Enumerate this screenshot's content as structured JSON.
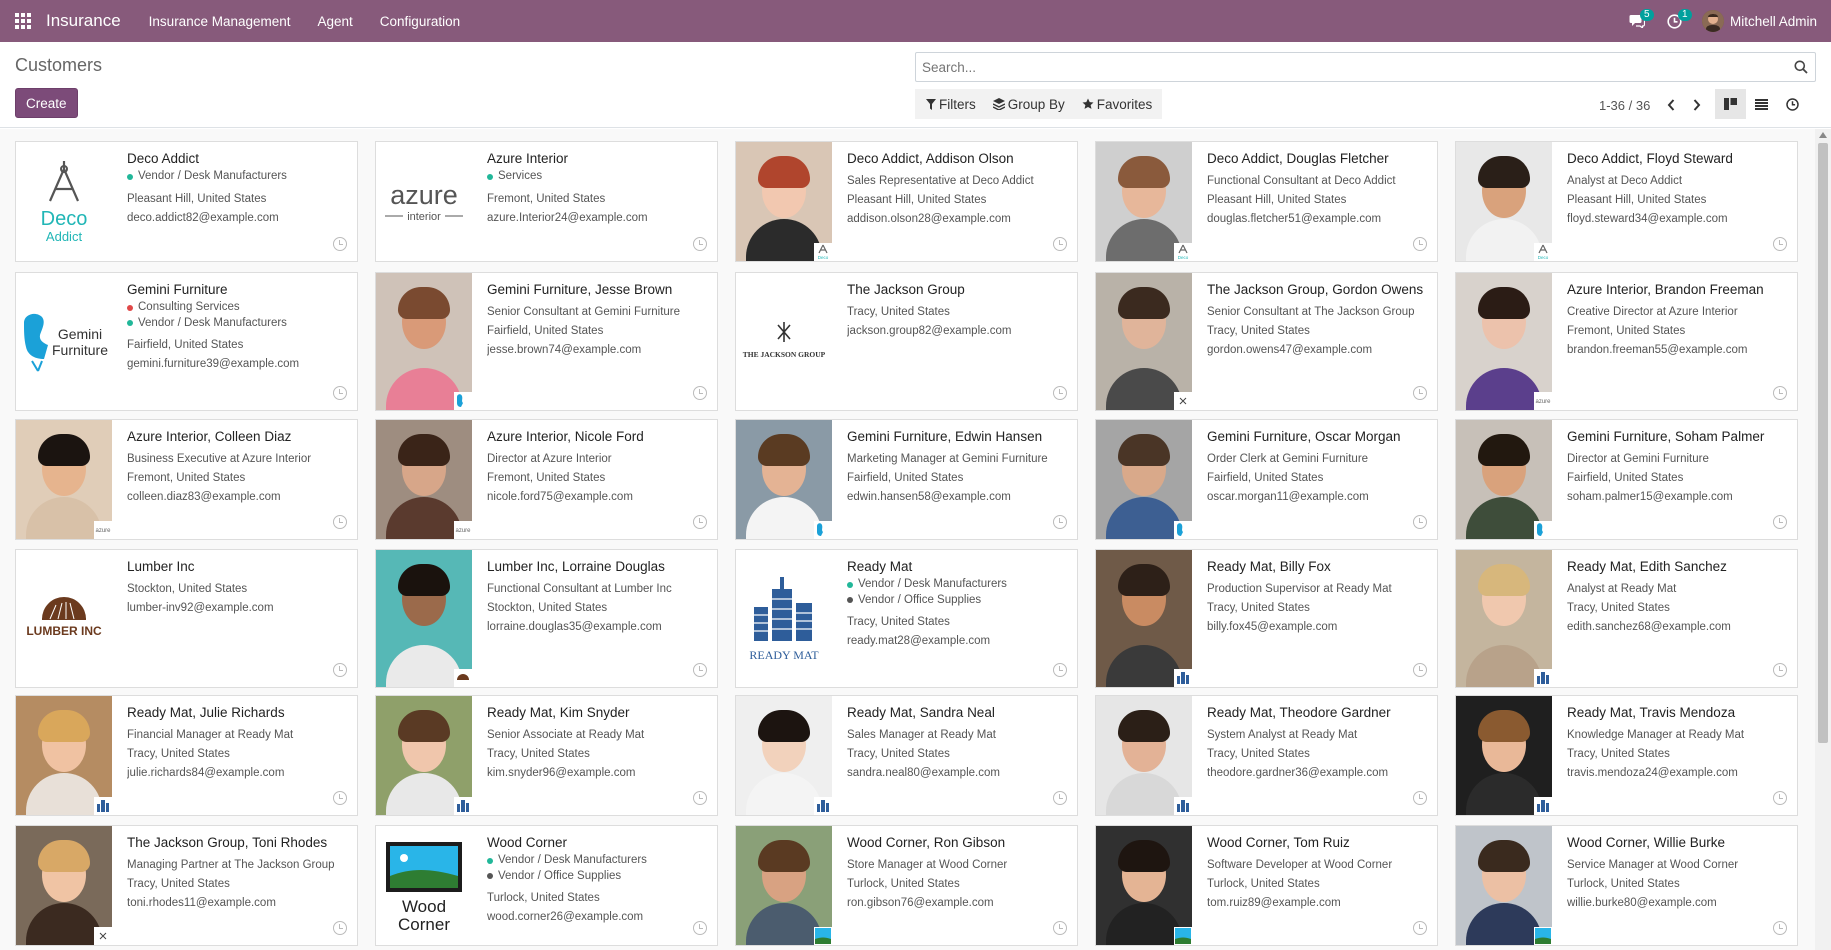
{
  "navbar": {
    "brand": "Insurance",
    "menus": [
      "Insurance Management",
      "Agent",
      "Configuration"
    ],
    "messages_count": "5",
    "activities_count": "1",
    "user_name": "Mitchell Admin",
    "color": "#875a7b"
  },
  "control_panel": {
    "title": "Customers",
    "create_label": "Create",
    "search_placeholder": "Search...",
    "filters_label": "Filters",
    "group_by_label": "Group By",
    "favorites_label": "Favorites",
    "pager": "1-36 / 36"
  },
  "tag_colors": {
    "green": "#21b799",
    "red": "#e04848",
    "dark": "#555555"
  },
  "cards": [
    {
      "name": "Deco Addict",
      "tags": [
        {
          "label": "Vendor / Desk Manufacturers",
          "color": "green"
        }
      ],
      "lines": [
        "Pleasant Hill, United States",
        "deco.addict82@example.com"
      ],
      "image": "logo-deco",
      "logo_text": [
        "Deco",
        "Addict"
      ]
    },
    {
      "name": "Azure Interior",
      "tags": [
        {
          "label": "Services",
          "color": "green"
        }
      ],
      "lines": [
        "Fremont, United States",
        "azure.Interior24@example.com"
      ],
      "image": "logo-azure",
      "logo_text": [
        "azure",
        "interior"
      ]
    },
    {
      "name": "Deco Addict, Addison Olson",
      "tags": [],
      "lines": [
        "Sales Representative at Deco Addict",
        "Pleasant Hill, United States",
        "addison.olson28@example.com"
      ],
      "image": "portrait",
      "hair": "#b0452d",
      "skin": "#f2c8b0",
      "shirt": "#2b2b2b",
      "bg": "#d9c6b5",
      "mini": "deco"
    },
    {
      "name": "Deco Addict, Douglas Fletcher",
      "tags": [],
      "lines": [
        "Functional Consultant at Deco Addict",
        "Pleasant Hill, United States",
        "douglas.fletcher51@example.com"
      ],
      "image": "portrait",
      "hair": "#8a5a3c",
      "skin": "#e7b79a",
      "shirt": "#6d6d6d",
      "bg": "#cfcfcf",
      "mini": "deco"
    },
    {
      "name": "Deco Addict, Floyd Steward",
      "tags": [],
      "lines": [
        "Analyst at Deco Addict",
        "Pleasant Hill, United States",
        "floyd.steward34@example.com"
      ],
      "image": "portrait",
      "hair": "#2a1f18",
      "skin": "#d9a27c",
      "shirt": "#f2f2f2",
      "bg": "#e8e8e8",
      "mini": "deco"
    },
    {
      "name": "Gemini Furniture",
      "tags": [
        {
          "label": "Consulting Services",
          "color": "red"
        },
        {
          "label": "Vendor / Desk Manufacturers",
          "color": "green"
        }
      ],
      "lines": [
        "Fairfield, United States",
        "gemini.furniture39@example.com"
      ],
      "image": "logo-gemini",
      "logo_text": [
        "Gemini",
        "Furniture"
      ]
    },
    {
      "name": "Gemini Furniture, Jesse Brown",
      "tags": [],
      "lines": [
        "Senior Consultant at Gemini Furniture",
        "Fairfield, United States",
        "jesse.brown74@example.com"
      ],
      "image": "portrait",
      "hair": "#7a4a30",
      "skin": "#d99a78",
      "shirt": "#e87f96",
      "bg": "#cfc2b8",
      "mini": "gemini"
    },
    {
      "name": "The Jackson Group",
      "tags": [],
      "lines": [
        "Tracy, United States",
        "jackson.group82@example.com"
      ],
      "image": "logo-jackson",
      "logo_text": [
        "THE JACKSON GROUP"
      ]
    },
    {
      "name": "The Jackson Group, Gordon Owens",
      "tags": [],
      "lines": [
        "Senior Consultant at The Jackson Group",
        "Tracy, United States",
        "gordon.owens47@example.com"
      ],
      "image": "portrait",
      "hair": "#3b2a1f",
      "skin": "#e0b49a",
      "shirt": "#4a4a4a",
      "bg": "#b9b2a8",
      "mini": "jackson"
    },
    {
      "name": "Azure Interior, Brandon Freeman",
      "tags": [],
      "lines": [
        "Creative Director at Azure Interior",
        "Fremont, United States",
        "brandon.freeman55@example.com"
      ],
      "image": "portrait",
      "hair": "#2b1c15",
      "skin": "#ecc2ac",
      "shirt": "#5b3f8c",
      "bg": "#d8d2cc",
      "mini": "azure"
    },
    {
      "name": "Azure Interior, Colleen Diaz",
      "tags": [],
      "lines": [
        "Business Executive at Azure Interior",
        "Fremont, United States",
        "colleen.diaz83@example.com"
      ],
      "image": "portrait",
      "hair": "#1b1410",
      "skin": "#e6b48e",
      "shirt": "#d8c1a8",
      "bg": "#e0cdb8",
      "mini": "azure"
    },
    {
      "name": "Azure Interior, Nicole Ford",
      "tags": [],
      "lines": [
        "Director at Azure Interior",
        "Fremont, United States",
        "nicole.ford75@example.com"
      ],
      "image": "portrait",
      "hair": "#3a2418",
      "skin": "#d7a689",
      "shirt": "#5a3a2e",
      "bg": "#9e8d80",
      "mini": "azure"
    },
    {
      "name": "Gemini Furniture, Edwin Hansen",
      "tags": [],
      "lines": [
        "Marketing Manager at Gemini Furniture",
        "Fairfield, United States",
        "edwin.hansen58@example.com"
      ],
      "image": "portrait",
      "hair": "#5a3b22",
      "skin": "#e4b394",
      "shirt": "#f4f4f4",
      "bg": "#8a9aa6",
      "mini": "gemini"
    },
    {
      "name": "Gemini Furniture, Oscar Morgan",
      "tags": [],
      "lines": [
        "Order Clerk at Gemini Furniture",
        "Fairfield, United States",
        "oscar.morgan11@example.com"
      ],
      "image": "portrait",
      "hair": "#4a3526",
      "skin": "#d9a98a",
      "shirt": "#3d5f92",
      "bg": "#a5a5a5",
      "mini": "gemini"
    },
    {
      "name": "Gemini Furniture, Soham Palmer",
      "tags": [],
      "lines": [
        "Director at Gemini Furniture",
        "Fairfield, United States",
        "soham.palmer15@example.com"
      ],
      "image": "portrait",
      "hair": "#22180f",
      "skin": "#d9a27c",
      "shirt": "#3e4d3a",
      "bg": "#c7c0b8",
      "mini": "gemini"
    },
    {
      "name": "Lumber Inc",
      "tags": [],
      "lines": [
        "Stockton, United States",
        "lumber-inv92@example.com"
      ],
      "image": "logo-lumber",
      "logo_text": [
        "LUMBER INC"
      ]
    },
    {
      "name": "Lumber Inc, Lorraine Douglas",
      "tags": [],
      "lines": [
        "Functional Consultant at Lumber Inc",
        "Stockton, United States",
        "lorraine.douglas35@example.com"
      ],
      "image": "portrait",
      "hair": "#1a120d",
      "skin": "#9b6a4b",
      "shirt": "#eaeaea",
      "bg": "#56b8b6",
      "mini": "lumber"
    },
    {
      "name": "Ready Mat",
      "tags": [
        {
          "label": "Vendor / Desk Manufacturers",
          "color": "green"
        },
        {
          "label": "Vendor / Office Supplies",
          "color": "dark"
        }
      ],
      "lines": [
        "Tracy, United States",
        "ready.mat28@example.com"
      ],
      "image": "logo-readymat",
      "logo_text": [
        "READY MAT"
      ]
    },
    {
      "name": "Ready Mat, Billy Fox",
      "tags": [],
      "lines": [
        "Production Supervisor at Ready Mat",
        "Tracy, United States",
        "billy.fox45@example.com"
      ],
      "image": "portrait",
      "hair": "#2d2018",
      "skin": "#c98b62",
      "shirt": "#3a3a3a",
      "bg": "#6f5a48",
      "mini": "readymat"
    },
    {
      "name": "Ready Mat, Edith Sanchez",
      "tags": [],
      "lines": [
        "Analyst at Ready Mat",
        "Tracy, United States",
        "edith.sanchez68@example.com"
      ],
      "image": "portrait",
      "hair": "#d7b77c",
      "skin": "#f0c8ae",
      "shirt": "#b8a28a",
      "bg": "#c4b59e",
      "mini": "readymat"
    },
    {
      "name": "Ready Mat, Julie Richards",
      "tags": [],
      "lines": [
        "Financial Manager at Ready Mat",
        "Tracy, United States",
        "julie.richards84@example.com"
      ],
      "image": "portrait",
      "hair": "#d9a75b",
      "skin": "#f0c2a2",
      "shirt": "#e8e0d8",
      "bg": "#b58c62",
      "mini": "readymat"
    },
    {
      "name": "Ready Mat, Kim Snyder",
      "tags": [],
      "lines": [
        "Senior Associate at Ready Mat",
        "Tracy, United States",
        "kim.snyder96@example.com"
      ],
      "image": "portrait",
      "hair": "#5a3a24",
      "skin": "#f0c6ac",
      "shirt": "#e8e8e8",
      "bg": "#8fa06a",
      "mini": "readymat"
    },
    {
      "name": "Ready Mat, Sandra Neal",
      "tags": [],
      "lines": [
        "Sales Manager at Ready Mat",
        "Tracy, United States",
        "sandra.neal80@example.com"
      ],
      "image": "portrait",
      "hair": "#1c1410",
      "skin": "#f2d2bc",
      "shirt": "#f4f4f4",
      "bg": "#efefef",
      "mini": "readymat"
    },
    {
      "name": "Ready Mat, Theodore Gardner",
      "tags": [],
      "lines": [
        "System Analyst at Ready Mat",
        "Tracy, United States",
        "theodore.gardner36@example.com"
      ],
      "image": "portrait",
      "hair": "#2b1f17",
      "skin": "#e3b296",
      "shirt": "#d8d8d8",
      "bg": "#e6e6e6",
      "mini": "readymat"
    },
    {
      "name": "Ready Mat, Travis Mendoza",
      "tags": [],
      "lines": [
        "Knowledge Manager at Ready Mat",
        "Tracy, United States",
        "travis.mendoza24@example.com"
      ],
      "image": "portrait",
      "hair": "#8a5a30",
      "skin": "#e9b898",
      "shirt": "#2b2b2b",
      "bg": "#1f1f1f",
      "mini": "readymat"
    },
    {
      "name": "The Jackson Group, Toni Rhodes",
      "tags": [],
      "lines": [
        "Managing Partner at The Jackson Group",
        "Tracy, United States",
        "toni.rhodes11@example.com"
      ],
      "image": "portrait",
      "hair": "#d8a866",
      "skin": "#f0c4a4",
      "shirt": "#3b2a20",
      "bg": "#7a6a5a",
      "mini": "jackson"
    },
    {
      "name": "Wood Corner",
      "tags": [
        {
          "label": "Vendor / Desk Manufacturers",
          "color": "green"
        },
        {
          "label": "Vendor / Office Supplies",
          "color": "dark"
        }
      ],
      "lines": [
        "Turlock, United States",
        "wood.corner26@example.com"
      ],
      "image": "logo-wood",
      "logo_text": [
        "Wood",
        "Corner"
      ]
    },
    {
      "name": "Wood Corner, Ron Gibson",
      "tags": [],
      "lines": [
        "Store Manager at Wood Corner",
        "Turlock, United States",
        "ron.gibson76@example.com"
      ],
      "image": "portrait",
      "hair": "#5a3a22",
      "skin": "#d8a282",
      "shirt": "#4b5c6e",
      "bg": "#8aa078",
      "mini": "wood"
    },
    {
      "name": "Wood Corner, Tom Ruiz",
      "tags": [],
      "lines": [
        "Software Developer at Wood Corner",
        "Turlock, United States",
        "tom.ruiz89@example.com"
      ],
      "image": "portrait",
      "hair": "#1e1510",
      "skin": "#e4b494",
      "shirt": "#222222",
      "bg": "#303030",
      "mini": "wood"
    },
    {
      "name": "Wood Corner, Willie Burke",
      "tags": [],
      "lines": [
        "Service Manager at Wood Corner",
        "Turlock, United States",
        "willie.burke80@example.com"
      ],
      "image": "portrait",
      "hair": "#3a2a1e",
      "skin": "#ecc0a4",
      "shirt": "#2d3a5a",
      "bg": "#bfc4ca",
      "mini": "wood"
    }
  ]
}
